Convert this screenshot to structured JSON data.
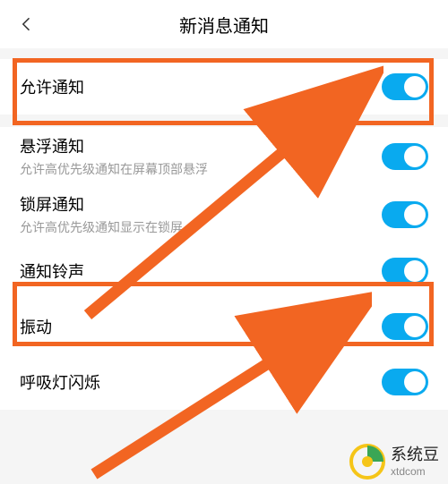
{
  "header": {
    "title": "新消息通知"
  },
  "rows": {
    "allow": {
      "label": "允许通知"
    },
    "float": {
      "label": "悬浮通知",
      "sub": "允许高优先级通知在屏幕顶部悬浮"
    },
    "lock": {
      "label": "锁屏通知",
      "sub": "允许高优先级通知显示在锁屏"
    },
    "sound": {
      "label": "通知铃声"
    },
    "vibrate": {
      "label": "振动"
    },
    "led": {
      "label": "呼吸灯闪烁"
    }
  },
  "watermark": {
    "name": "系统豆",
    "url": "xtdcom"
  },
  "colors": {
    "toggleOn": "#09aaef",
    "highlight": "#f26522"
  }
}
